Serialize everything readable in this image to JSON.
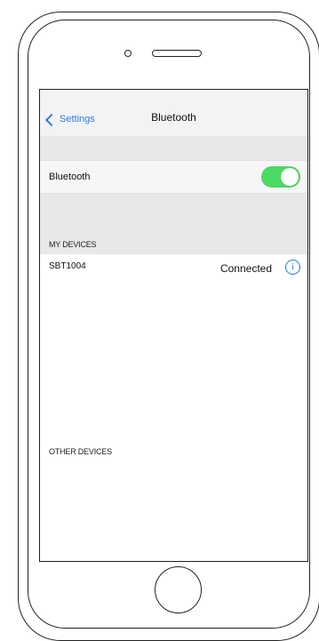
{
  "nav": {
    "back_label": "Settings",
    "title": "Bluetooth"
  },
  "bluetooth": {
    "label": "Bluetooth",
    "enabled": true,
    "toggle_color": "#4cd964"
  },
  "my_devices": {
    "header": "MY DEVICES",
    "items": [
      {
        "name": "SBT1004",
        "status": "Connected",
        "icon": "info-icon"
      }
    ]
  },
  "other_devices": {
    "header": "OTHER DEVICES"
  },
  "colors": {
    "accent": "#2a7de1",
    "section_bg": "#e8e8ea"
  }
}
